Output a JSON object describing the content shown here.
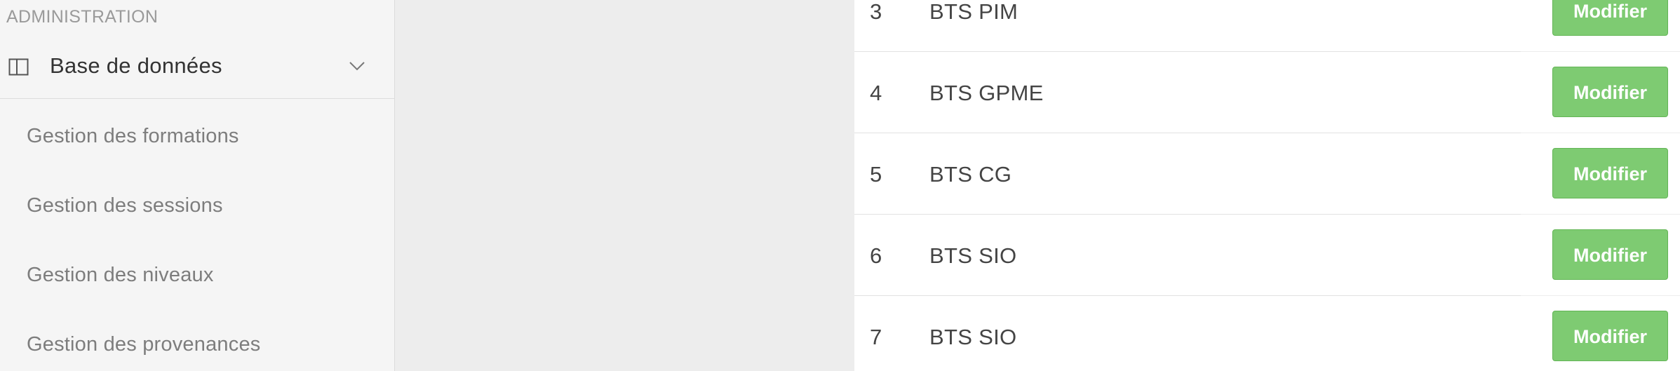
{
  "sidebar": {
    "section_title": "ADMINISTRATION",
    "database_item": {
      "label": "Base de données",
      "icon": "columns-icon",
      "chevron": "chevron-down-icon"
    },
    "menu_items": [
      {
        "label": "Gestion des formations"
      },
      {
        "label": "Gestion des sessions"
      },
      {
        "label": "Gestion des niveaux"
      },
      {
        "label": "Gestion des provenances"
      }
    ]
  },
  "table": {
    "action_label": "Modifier",
    "accent_color": "#7ecb72",
    "rows": [
      {
        "id": "3",
        "name": "BTS PIM"
      },
      {
        "id": "4",
        "name": "BTS GPME"
      },
      {
        "id": "5",
        "name": "BTS CG"
      },
      {
        "id": "6",
        "name": "BTS SIO"
      },
      {
        "id": "7",
        "name": "BTS SIO"
      }
    ]
  }
}
